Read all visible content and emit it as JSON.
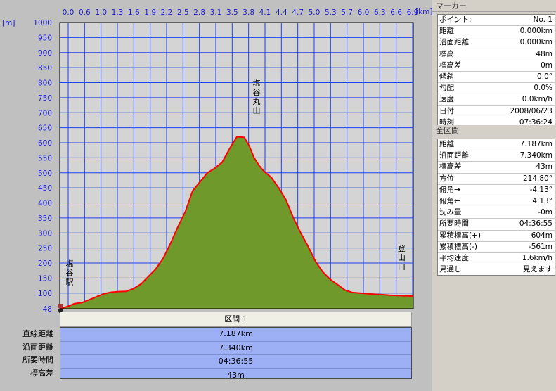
{
  "chart_data": {
    "type": "area",
    "xlabel": "[km]",
    "ylabel": "[m]",
    "xlim": [
      0,
      7.187
    ],
    "ylim": [
      48,
      1000
    ],
    "x_ticks": [
      "0.0",
      "0.6",
      "1.0",
      "1.3",
      "1.6",
      "1.9",
      "2.2",
      "2.5",
      "2.8",
      "3.1",
      "3.5",
      "3.8",
      "4.1",
      "4.4",
      "4.7",
      "5.0",
      "5.3",
      "5.7",
      "6.0",
      "6.3",
      "6.6",
      "6.9"
    ],
    "y_ticks": [
      1000,
      950,
      900,
      850,
      800,
      750,
      700,
      650,
      600,
      550,
      500,
      450,
      400,
      350,
      300,
      250,
      200,
      150,
      100
    ],
    "y_min_label": "48",
    "x": [
      0,
      0.15,
      0.3,
      0.45,
      0.6,
      0.75,
      0.9,
      1.05,
      1.2,
      1.35,
      1.5,
      1.65,
      1.8,
      1.95,
      2.1,
      2.25,
      2.4,
      2.55,
      2.7,
      2.85,
      3.0,
      3.15,
      3.3,
      3.45,
      3.6,
      3.75,
      3.85,
      3.95,
      4.05,
      4.15,
      4.3,
      4.45,
      4.6,
      4.75,
      4.9,
      5.05,
      5.2,
      5.35,
      5.5,
      5.65,
      5.8,
      5.95,
      6.1,
      6.25,
      6.4,
      6.55,
      6.7,
      6.85,
      7.0,
      7.187
    ],
    "y": [
      48,
      55,
      65,
      68,
      78,
      88,
      98,
      103,
      105,
      106,
      115,
      130,
      155,
      180,
      215,
      265,
      320,
      370,
      440,
      470,
      500,
      515,
      535,
      580,
      620,
      618,
      590,
      550,
      525,
      505,
      485,
      450,
      410,
      350,
      300,
      255,
      205,
      170,
      145,
      128,
      110,
      102,
      100,
      98,
      96,
      95,
      93,
      92,
      91,
      90
    ],
    "fill_color": "#6f9a2b",
    "line_color": "#ff0000",
    "plot_bg": "#d4d4d4",
    "grid_color": "#2040ee",
    "annotations": [
      {
        "text": "塩谷駅",
        "x": 0.2,
        "y": 190
      },
      {
        "text": "塩谷丸山",
        "x": 4.0,
        "y": 790
      },
      {
        "text": "登山口",
        "x": 6.95,
        "y": 240
      }
    ]
  },
  "section": {
    "title": "区間 1",
    "labels": [
      "直線距離",
      "沿面距離",
      "所要時間",
      "標高差"
    ],
    "values": [
      "7.187km",
      "7.340km",
      "04:36:55",
      "43m"
    ]
  },
  "marker_panel": {
    "title": "マーカー",
    "rows": [
      {
        "k": "ポイント:",
        "v": "No. 1"
      },
      {
        "k": "距離",
        "v": "0.000km"
      },
      {
        "k": "沿面距離",
        "v": "0.000km"
      },
      {
        "k": "標高",
        "v": "48m"
      },
      {
        "k": "標高差",
        "v": "0m"
      },
      {
        "k": "傾斜",
        "v": "0.0°"
      },
      {
        "k": "勾配",
        "v": "0.0%"
      },
      {
        "k": "速度",
        "v": "0.0km/h"
      },
      {
        "k": "日付",
        "v": "2008/06/23"
      },
      {
        "k": "時刻",
        "v": "07:36:24"
      }
    ]
  },
  "all_section_panel": {
    "title": "全区間",
    "rows": [
      {
        "k": "距離",
        "v": "7.187km"
      },
      {
        "k": "沿面距離",
        "v": "7.340km"
      },
      {
        "k": "標高差",
        "v": "43m"
      },
      {
        "k": "方位",
        "v": "214.80°"
      },
      {
        "k": "俯角→",
        "v": "-4.13°"
      },
      {
        "k": "俯角←",
        "v": "4.13°"
      },
      {
        "k": "沈み量",
        "v": "-0m"
      },
      {
        "k": "所要時間",
        "v": "04:36:55"
      },
      {
        "k": "累積標高(+)",
        "v": "604m"
      },
      {
        "k": "累積標高(-)",
        "v": "-561m"
      },
      {
        "k": "平均速度",
        "v": "1.6km/h"
      },
      {
        "k": "見通し",
        "v": "見えます"
      }
    ]
  }
}
